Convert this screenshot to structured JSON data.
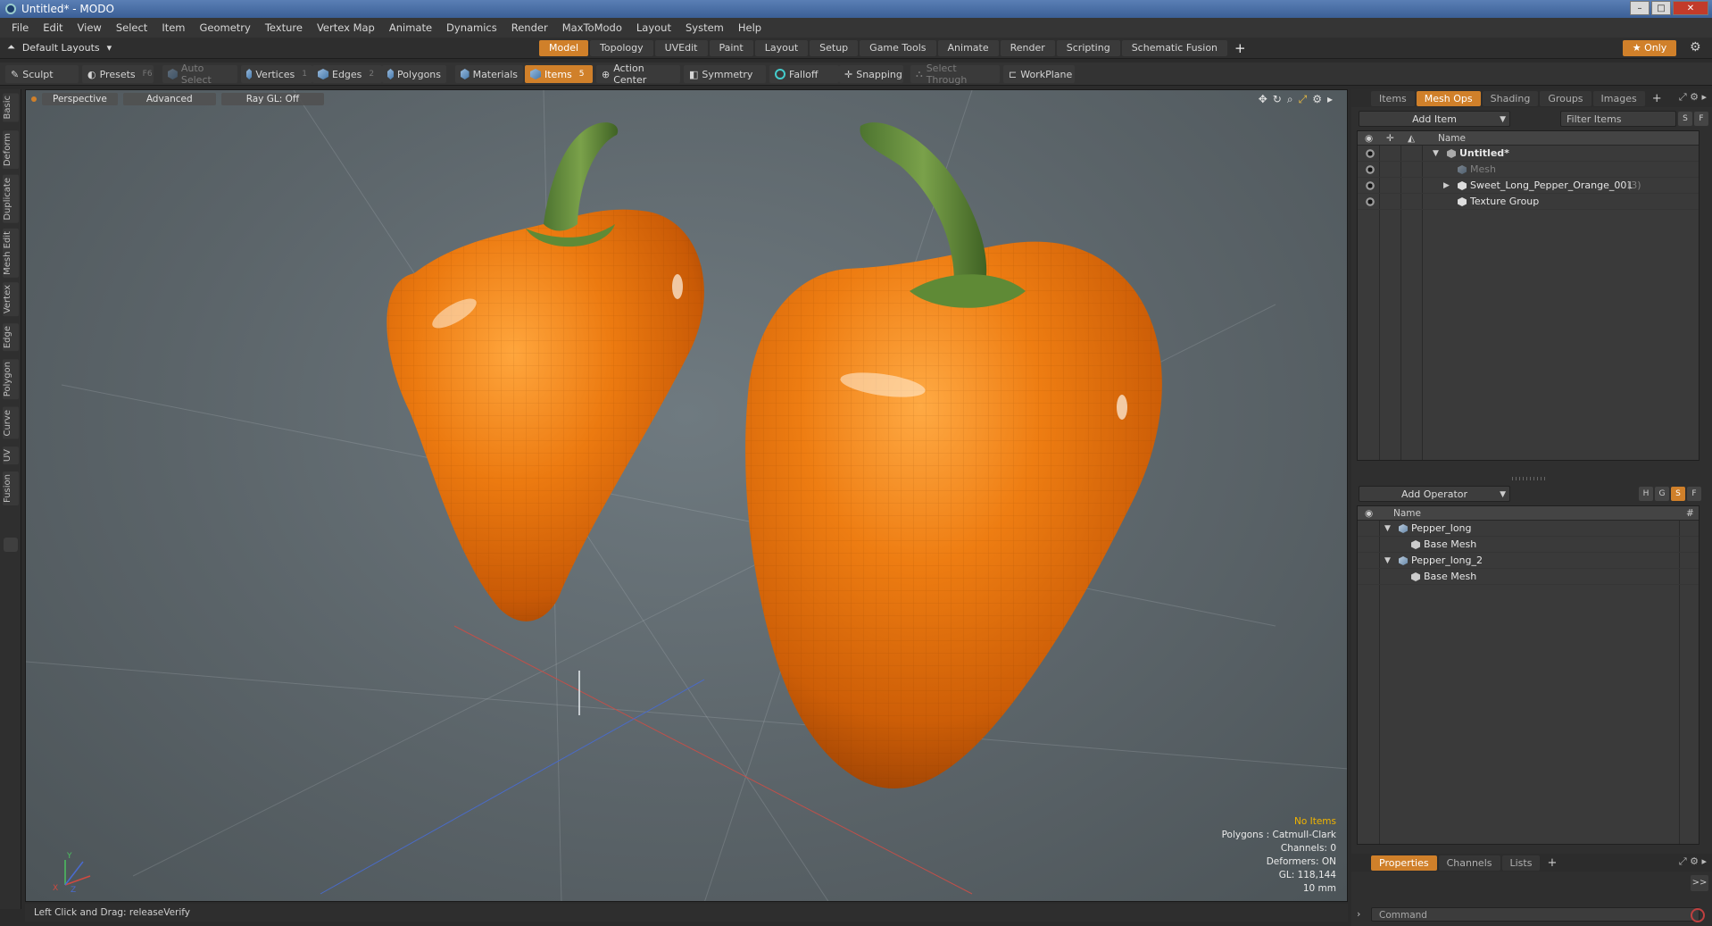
{
  "window": {
    "title": "Untitled* - MODO",
    "controls": [
      "–",
      "□",
      "✕"
    ]
  },
  "menu": [
    "File",
    "Edit",
    "View",
    "Select",
    "Item",
    "Geometry",
    "Texture",
    "Vertex Map",
    "Animate",
    "Dynamics",
    "Render",
    "MaxToModo",
    "Layout",
    "System",
    "Help"
  ],
  "layout_bar": {
    "layouts_label": "Default Layouts",
    "tabs": [
      "Model",
      "Topology",
      "UVEdit",
      "Paint",
      "Layout",
      "Setup",
      "Game Tools",
      "Animate",
      "Render",
      "Scripting",
      "Schematic Fusion"
    ],
    "active_tab": "Model",
    "plus": "+",
    "only": "Only",
    "only_star": "★"
  },
  "toolbar": {
    "sculpt": "Sculpt",
    "presets": "Presets",
    "presets_key": "F6",
    "auto_select": "Auto Select",
    "vertices": "Vertices",
    "vertices_key": "1",
    "edges": "Edges",
    "edges_key": "2",
    "polygons": "Polygons",
    "materials": "Materials",
    "items": "Items",
    "items_key": "5",
    "action_center": "Action Center",
    "symmetry": "Symmetry",
    "falloff": "Falloff",
    "snapping": "Snapping",
    "select_through": "Select Through",
    "workplane": "WorkPlane"
  },
  "left_tabs": [
    "Basic",
    "Deform",
    "Duplicate",
    "Mesh Edit",
    "Vertex",
    "Edge",
    "Polygon",
    "Curve",
    "UV",
    "Fusion"
  ],
  "viewport": {
    "view_type": "Perspective",
    "shading": "Advanced",
    "raygl": "Ray GL: Off",
    "info": {
      "items": "No Items",
      "polygons": "Polygons : Catmull-Clark",
      "channels": "Channels: 0",
      "deformers": "Deformers: ON",
      "gl": "GL: 118,144",
      "scale": "10 mm"
    },
    "axis_labels": {
      "x": "X",
      "y": "Y",
      "z": "Z"
    }
  },
  "status_bar": {
    "text": "Left Click and Drag:  releaseVerify"
  },
  "colors": {
    "accent": "#d0802a",
    "pepper": "#e57a10",
    "stem": "#5f8a36",
    "warning": "#f1b400"
  },
  "items_panel": {
    "tabs": [
      "Items",
      "Mesh Ops",
      "Shading",
      "Groups",
      "Images"
    ],
    "active_tab": "Mesh Ops",
    "add_item": "Add Item",
    "filter_placeholder": "Filter Items",
    "s_btn": "S",
    "f_btn": "F",
    "header_name": "Name",
    "rows": [
      {
        "label": "Untitled*",
        "level": 0
      },
      {
        "label": "Mesh",
        "level": 1
      },
      {
        "label": "Sweet_Long_Pepper_Orange_001",
        "count": "(3)",
        "level": 1
      },
      {
        "label": "Texture Group",
        "level": 1
      }
    ]
  },
  "mesh_ops_panel": {
    "add_operator": "Add Operator",
    "header_name": "Name",
    "header_hash": "#",
    "btns": [
      "H",
      "G",
      "S",
      "F"
    ],
    "rows": [
      {
        "label": "Pepper_long",
        "level": 0
      },
      {
        "label": "Base Mesh",
        "level": 1
      },
      {
        "label": "Pepper_long_2",
        "level": 0
      },
      {
        "label": "Base Mesh",
        "level": 1
      }
    ]
  },
  "properties_panel": {
    "tabs": [
      "Properties",
      "Channels",
      "Lists"
    ],
    "active_tab": "Properties",
    "expand": ">>"
  },
  "command": {
    "placeholder": "Command"
  }
}
